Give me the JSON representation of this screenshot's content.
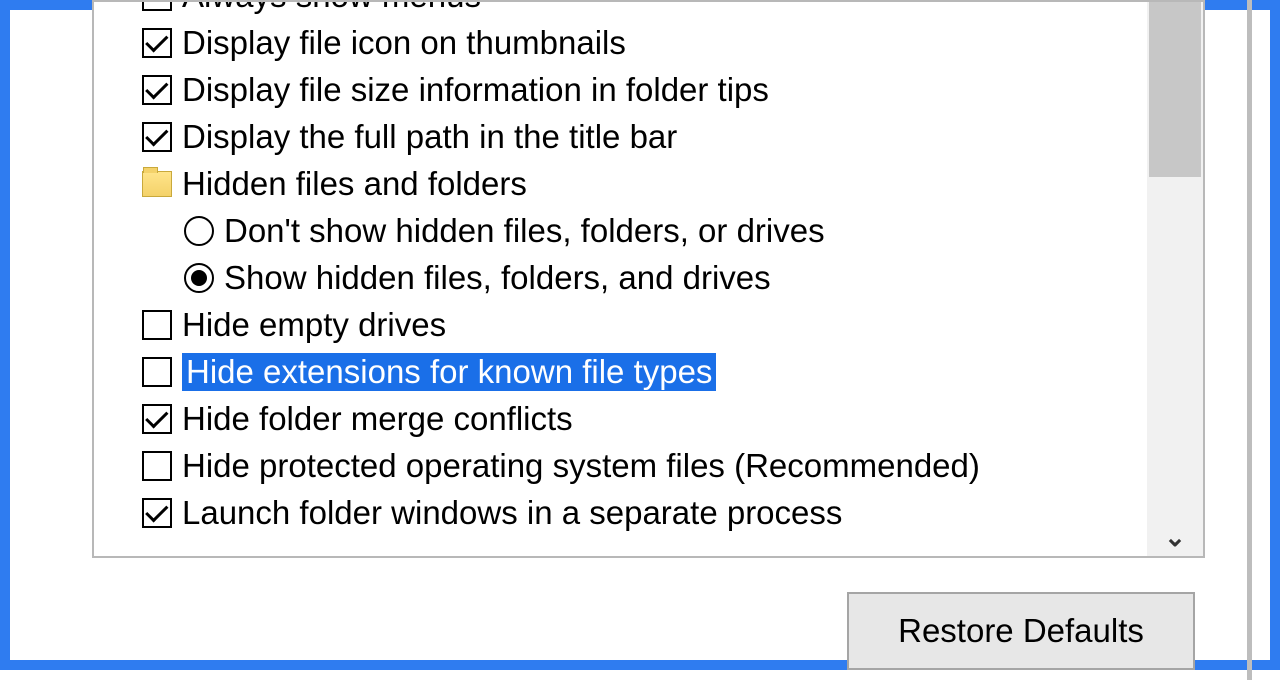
{
  "options": {
    "always_show_menus": "Always show menus",
    "display_file_icon": "Display file icon on thumbnails",
    "display_file_size": "Display file size information in folder tips",
    "display_full_path": "Display the full path in the title bar",
    "hidden_group": "Hidden files and folders",
    "dont_show_hidden": "Don't show hidden files, folders, or drives",
    "show_hidden": "Show hidden files, folders, and drives",
    "hide_empty_drives": "Hide empty drives",
    "hide_extensions": "Hide extensions for known file types",
    "hide_merge_conflicts": "Hide folder merge conflicts",
    "hide_protected": "Hide protected operating system files (Recommended)",
    "launch_separate": "Launch folder windows in a separate process"
  },
  "buttons": {
    "restore_defaults": "Restore Defaults"
  }
}
